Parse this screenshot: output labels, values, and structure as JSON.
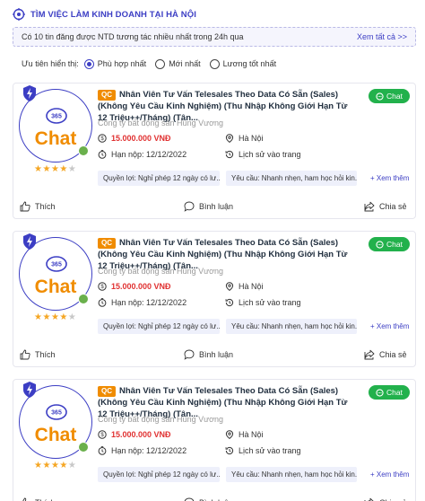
{
  "header": {
    "title": "TÌM VIỆC LÀM KINH DOANH TẠI HÀ NỘI",
    "icon": "target-icon"
  },
  "notice": {
    "text": "Có 10 tin đăng được NTD tương tác nhiều nhất trong 24h qua",
    "link": "Xem tất cả >>"
  },
  "priority": {
    "label": "Ưu tiên hiển thị:",
    "options": [
      {
        "label": "Phù hợp nhất",
        "selected": true
      },
      {
        "label": "Mới nhất",
        "selected": false
      },
      {
        "label": "Lương tốt nhất",
        "selected": false
      }
    ]
  },
  "jobs": [
    {
      "badge": "QC",
      "title": "Nhân Viên Tư Vấn Telesales Theo Data Có Sẵn (Sales) (Không Yêu Cầu Kinh Nghiệm) (Thu Nhập Không Giới Hạn Từ 12 Triệu++/Tháng) (Tân...",
      "company": "Công ty bất động sản Hùng Vương",
      "logo_text": "Chat",
      "rating": 4,
      "salary": "15.000.000 VNĐ",
      "location": "Hà Nội",
      "deadline": "Hạn nộp: 12/12/2022",
      "history": "Lịch sử vào trang",
      "tag1": "Quyền lợi: Nghỉ phép 12 ngày có lư...",
      "tag2": "Yêu cầu: Nhanh nhẹn, ham học hỏi kin...",
      "more": "+ Xem thêm",
      "chat": "Chat",
      "like": "Thích",
      "comment": "Bình luận",
      "share": "Chia sẻ"
    },
    {
      "badge": "QC",
      "title": "Nhân Viên Tư Vấn Telesales Theo Data Có Sẵn (Sales) (Không Yêu Cầu Kinh Nghiệm) (Thu Nhập Không Giới Hạn Từ 12 Triệu++/Tháng) (Tân...",
      "company": "Công ty bất động sản Hùng Vương",
      "logo_text": "Chat",
      "rating": 4,
      "salary": "15.000.000 VNĐ",
      "location": "Hà Nội",
      "deadline": "Hạn nộp: 12/12/2022",
      "history": "Lịch sử vào trang",
      "tag1": "Quyền lợi: Nghỉ phép 12 ngày có lư...",
      "tag2": "Yêu cầu: Nhanh nhẹn, ham học hỏi kin...",
      "more": "+ Xem thêm",
      "chat": "Chat",
      "like": "Thích",
      "comment": "Bình luận",
      "share": "Chia sẻ"
    },
    {
      "badge": "QC",
      "title": "Nhân Viên Tư Vấn Telesales Theo Data Có Sẵn (Sales) (Không Yêu Cầu Kinh Nghiệm) (Thu Nhập Không Giới Hạn Từ 12 Triệu++/Tháng) (Tân...",
      "company": "Công ty bất động sản Hùng Vương",
      "logo_text": "Chat",
      "rating": 4,
      "salary": "15.000.000 VNĐ",
      "location": "Hà Nội",
      "deadline": "Hạn nộp: 12/12/2022",
      "history": "Lịch sử vào trang",
      "tag1": "Quyền lợi: Nghỉ phép 12 ngày có lư...",
      "tag2": "Yêu cầu: Nhanh nhẹn, ham học hỏi kin...",
      "more": "+ Xem thêm",
      "chat": "Chat",
      "like": "Thích",
      "comment": "Bình luận",
      "share": "Chia sẻ"
    }
  ],
  "colors": {
    "accent": "#3c3ec4",
    "brand_orange": "#f08c00",
    "chat_green": "#22b14c",
    "salary_red": "#e03131"
  }
}
